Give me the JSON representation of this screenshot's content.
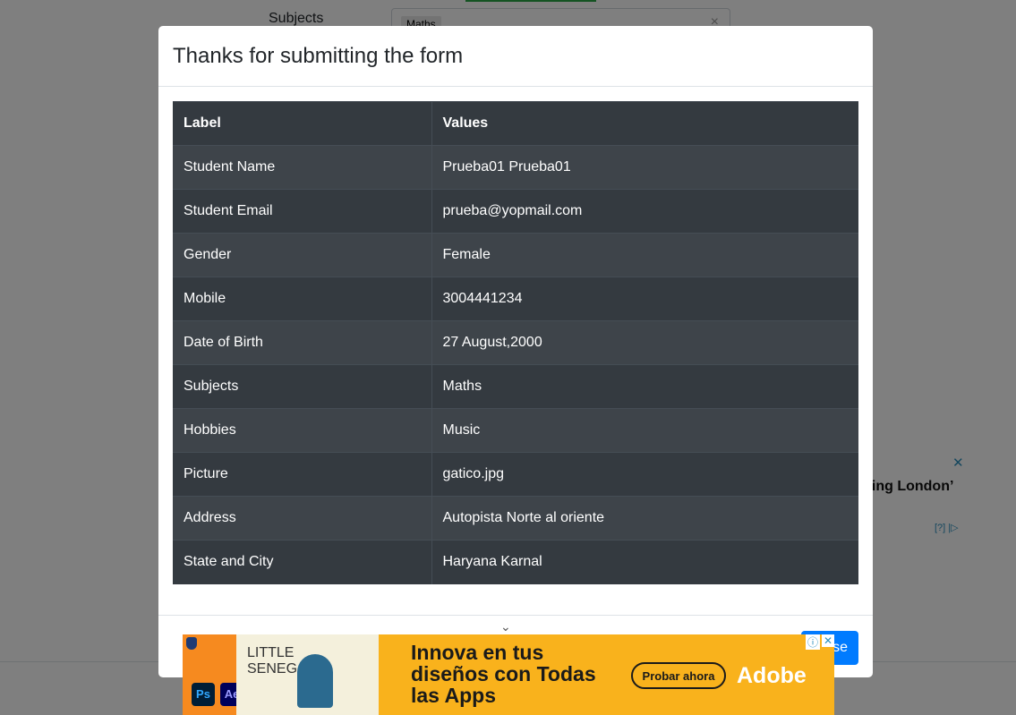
{
  "background": {
    "subjects_label": "Subjects",
    "subjects_chip": "Maths",
    "clear_icon": "×",
    "ad_text": "ying London’",
    "ad_close": "✕",
    "ad_marks": "[?] |▷"
  },
  "modal": {
    "title": "Thanks for submitting the form",
    "table": {
      "headers": [
        "Label",
        "Values"
      ],
      "rows": [
        [
          "Student Name",
          "Prueba01 Prueba01"
        ],
        [
          "Student Email",
          "prueba@yopmail.com"
        ],
        [
          "Gender",
          "Female"
        ],
        [
          "Mobile",
          "3004441234"
        ],
        [
          "Date of Birth",
          "27 August,2000"
        ],
        [
          "Subjects",
          "Maths"
        ],
        [
          "Hobbies",
          "Music"
        ],
        [
          "Picture",
          "gatico.jpg"
        ],
        [
          "Address",
          "Autopista Norte al oriente"
        ],
        [
          "State and City",
          "Haryana Karnal"
        ]
      ]
    },
    "close_button": "Close",
    "chevron": "⌄"
  },
  "ad": {
    "poster_text": "LITTLE SENEGAL",
    "ps_label": "Ps",
    "ae_label": "Ae",
    "headline": "Innova en tus diseños con Todas las Apps",
    "cta": "Probar ahora",
    "brand": "Adobe",
    "info_icon": "ⓘ",
    "close_icon": "✕"
  },
  "colors": {
    "primary": "#007bff",
    "table_dark": "#343a40",
    "ad_yellow": "#f9b21c"
  }
}
